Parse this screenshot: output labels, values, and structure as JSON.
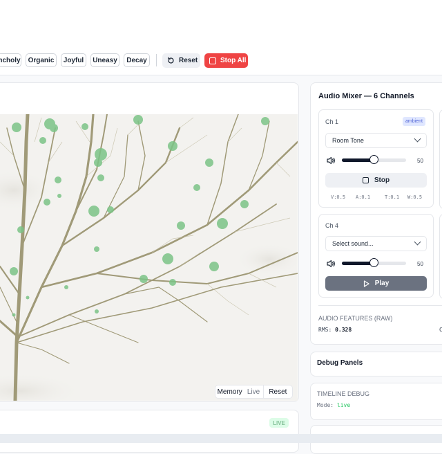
{
  "toolbar": {
    "moods": [
      {
        "label": "ncholy"
      },
      {
        "label": "Organic"
      },
      {
        "label": "Joyful"
      },
      {
        "label": "Uneasy"
      },
      {
        "label": "Decay"
      }
    ],
    "reset_label": "Reset",
    "stop_all_label": "Stop All"
  },
  "visualizer": {
    "view_modes": [
      "Memory",
      "Live"
    ],
    "active_mode": "Memory",
    "reset_label": "Reset",
    "live_badge": "LIVE"
  },
  "mixer": {
    "title": "Audio Mixer — 6 Channels",
    "channels": [
      {
        "label": "Ch 1",
        "tag": "ambient",
        "sound": "Room Tone",
        "volume": 50,
        "volume_display": "50",
        "action_label": "Stop",
        "params": [
          "V:0.5",
          "A:0.1",
          "T:0.1",
          "W:0.5"
        ]
      },
      {
        "label": "Ch 4",
        "sound_placeholder": "Select sound...",
        "volume": 50,
        "volume_display": "50",
        "action_label": "Play"
      }
    ],
    "features_label": "AUDIO FEATURES (RAW)",
    "rms_label": "RMS:",
    "rms_value": "0.328",
    "edge_text": "C"
  },
  "debug": {
    "title": "Debug Panels",
    "timeline_label": "TIMELINE DEBUG",
    "mode_label": "Mode:",
    "mode_value": "live"
  },
  "colors": {
    "accent_red": "#ef4444",
    "live_green": "#22c55e",
    "ambient_badge": "#e0e7ff",
    "slider": "#0f172a"
  }
}
